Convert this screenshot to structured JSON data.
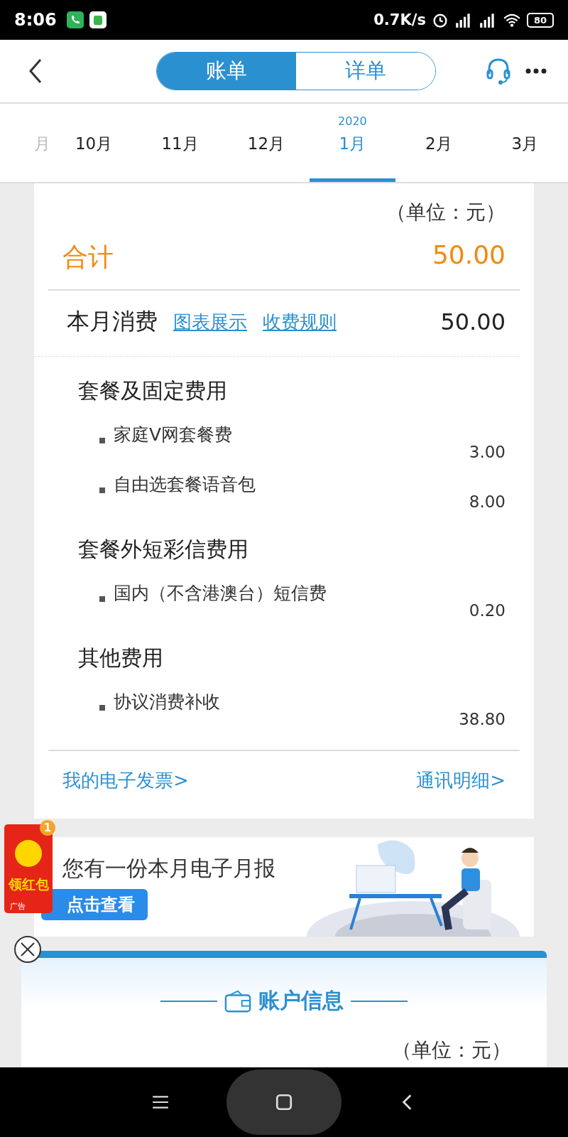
{
  "status_bar": {
    "time": "8:06",
    "speed": "0.7K/s",
    "battery": "80"
  },
  "header": {
    "tabs": [
      {
        "label": "账单",
        "selected": true
      },
      {
        "label": "详单",
        "selected": false
      }
    ]
  },
  "months": [
    {
      "label": "月",
      "selected": false
    },
    {
      "label": "10月",
      "selected": false
    },
    {
      "label": "11月",
      "selected": false
    },
    {
      "label": "12月",
      "selected": false
    },
    {
      "label": "1月",
      "year": "2020",
      "selected": true
    },
    {
      "label": "2月",
      "selected": false
    },
    {
      "label": "3月",
      "selected": false
    }
  ],
  "bill": {
    "unit": "（单位：元）",
    "total_label": "合计",
    "total_value": "50.00",
    "month_label": "本月消费",
    "links": [
      "图表展示",
      "收费规则"
    ],
    "month_value": "50.00",
    "sections": [
      {
        "title": "套餐及固定费用",
        "items": [
          {
            "name": "家庭V网套餐费",
            "amount": "3.00"
          },
          {
            "name": "自由选套餐语音包",
            "amount": "8.00"
          }
        ]
      },
      {
        "title": "套餐外短彩信费用",
        "items": [
          {
            "name": "国内（不含港澳台）短信费",
            "amount": "0.20"
          }
        ]
      },
      {
        "title": "其他费用",
        "items": [
          {
            "name": "协议消费补收",
            "amount": "38.80"
          }
        ]
      }
    ],
    "footer_links": [
      "我的电子发票>",
      "通讯明细>"
    ]
  },
  "ad": {
    "badge": "1",
    "packet": "领红包",
    "ad_tag": "广告",
    "title": "您有一份本月电子月报",
    "button": "点击查看"
  },
  "account": {
    "title": "账户信息",
    "unit": "（单位：元）"
  }
}
